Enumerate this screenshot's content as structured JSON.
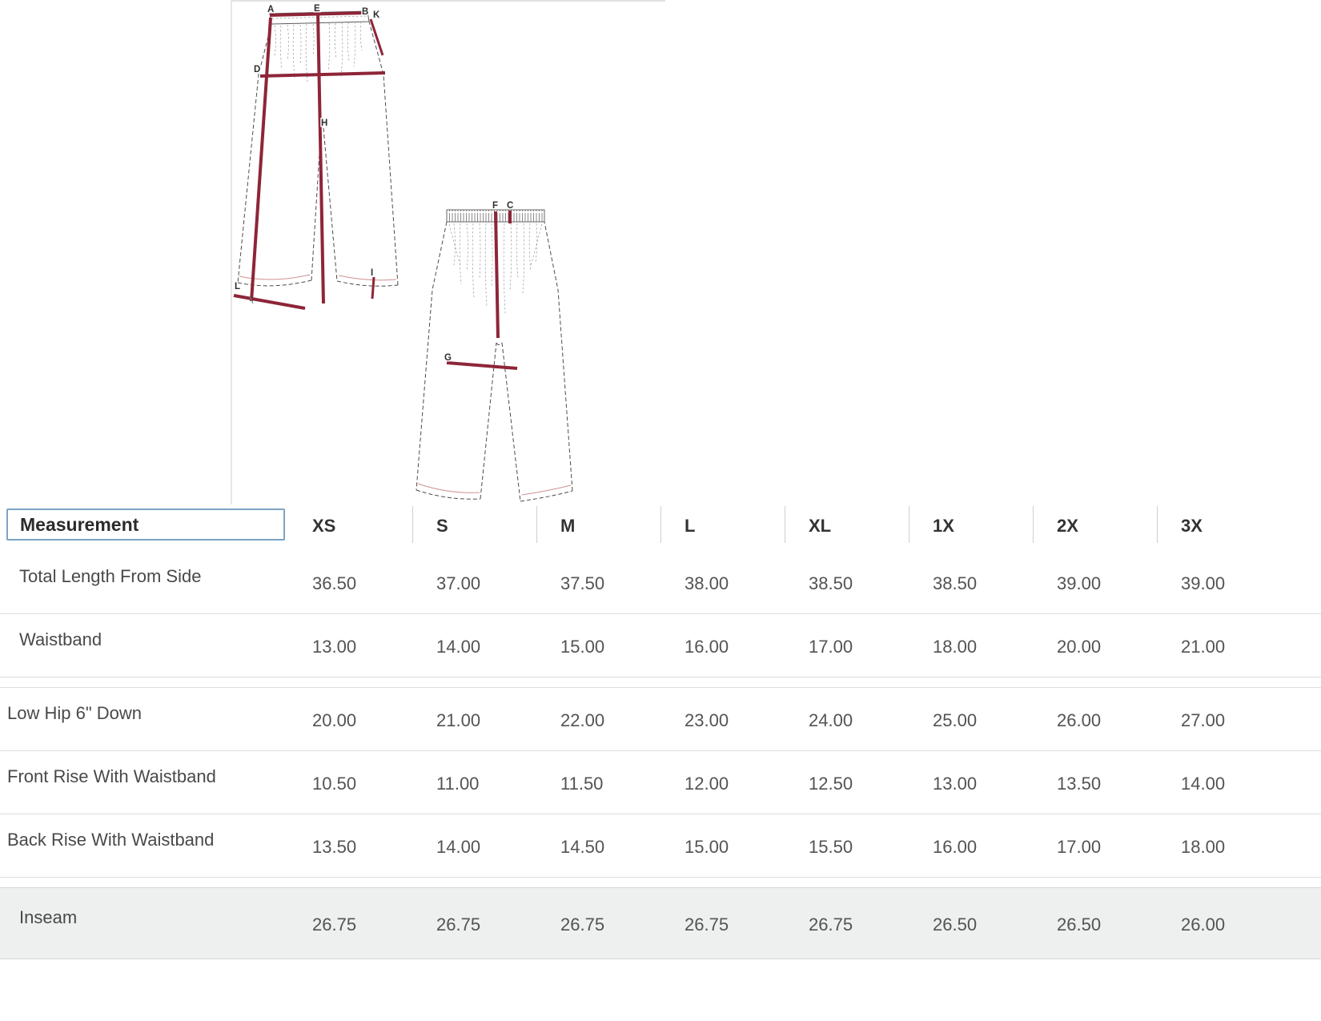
{
  "table": {
    "header": {
      "measurement": "Measurement",
      "sizes": [
        "XS",
        "S",
        "M",
        "L",
        "XL",
        "1X",
        "2X",
        "3X"
      ]
    },
    "rows": [
      {
        "label": "Total Length From Side",
        "values": [
          "36.50",
          "37.00",
          "37.50",
          "38.00",
          "38.50",
          "38.50",
          "39.00",
          "39.00"
        ]
      },
      {
        "label": "Waistband",
        "values": [
          "13.00",
          "14.00",
          "15.00",
          "16.00",
          "17.00",
          "18.00",
          "20.00",
          "21.00"
        ]
      },
      {
        "label": "Low Hip 6\" Down",
        "values": [
          "20.00",
          "21.00",
          "22.00",
          "23.00",
          "24.00",
          "25.00",
          "26.00",
          "27.00"
        ]
      },
      {
        "label": "Front Rise With Waistband",
        "values": [
          "10.50",
          "11.00",
          "11.50",
          "12.00",
          "12.50",
          "13.00",
          "13.50",
          "14.00"
        ]
      },
      {
        "label": "Back Rise With Waistband",
        "values": [
          "13.50",
          "14.00",
          "14.50",
          "15.00",
          "15.50",
          "16.00",
          "17.00",
          "18.00"
        ]
      },
      {
        "label": "Inseam",
        "values": [
          "26.75",
          "26.75",
          "26.75",
          "26.75",
          "26.75",
          "26.50",
          "26.50",
          "26.00"
        ]
      }
    ]
  },
  "diagram": {
    "front_labels": {
      "a": "A",
      "e": "E",
      "b": "B",
      "k": "K",
      "d": "D",
      "h": "H",
      "l": "L",
      "i": "I"
    },
    "back_labels": {
      "f": "F",
      "c": "C",
      "g": "G"
    }
  },
  "colors": {
    "measure_line": "#8e2538",
    "focus_box_border": "#7ba3c4",
    "alt_row_bg": "#edf0ef"
  }
}
